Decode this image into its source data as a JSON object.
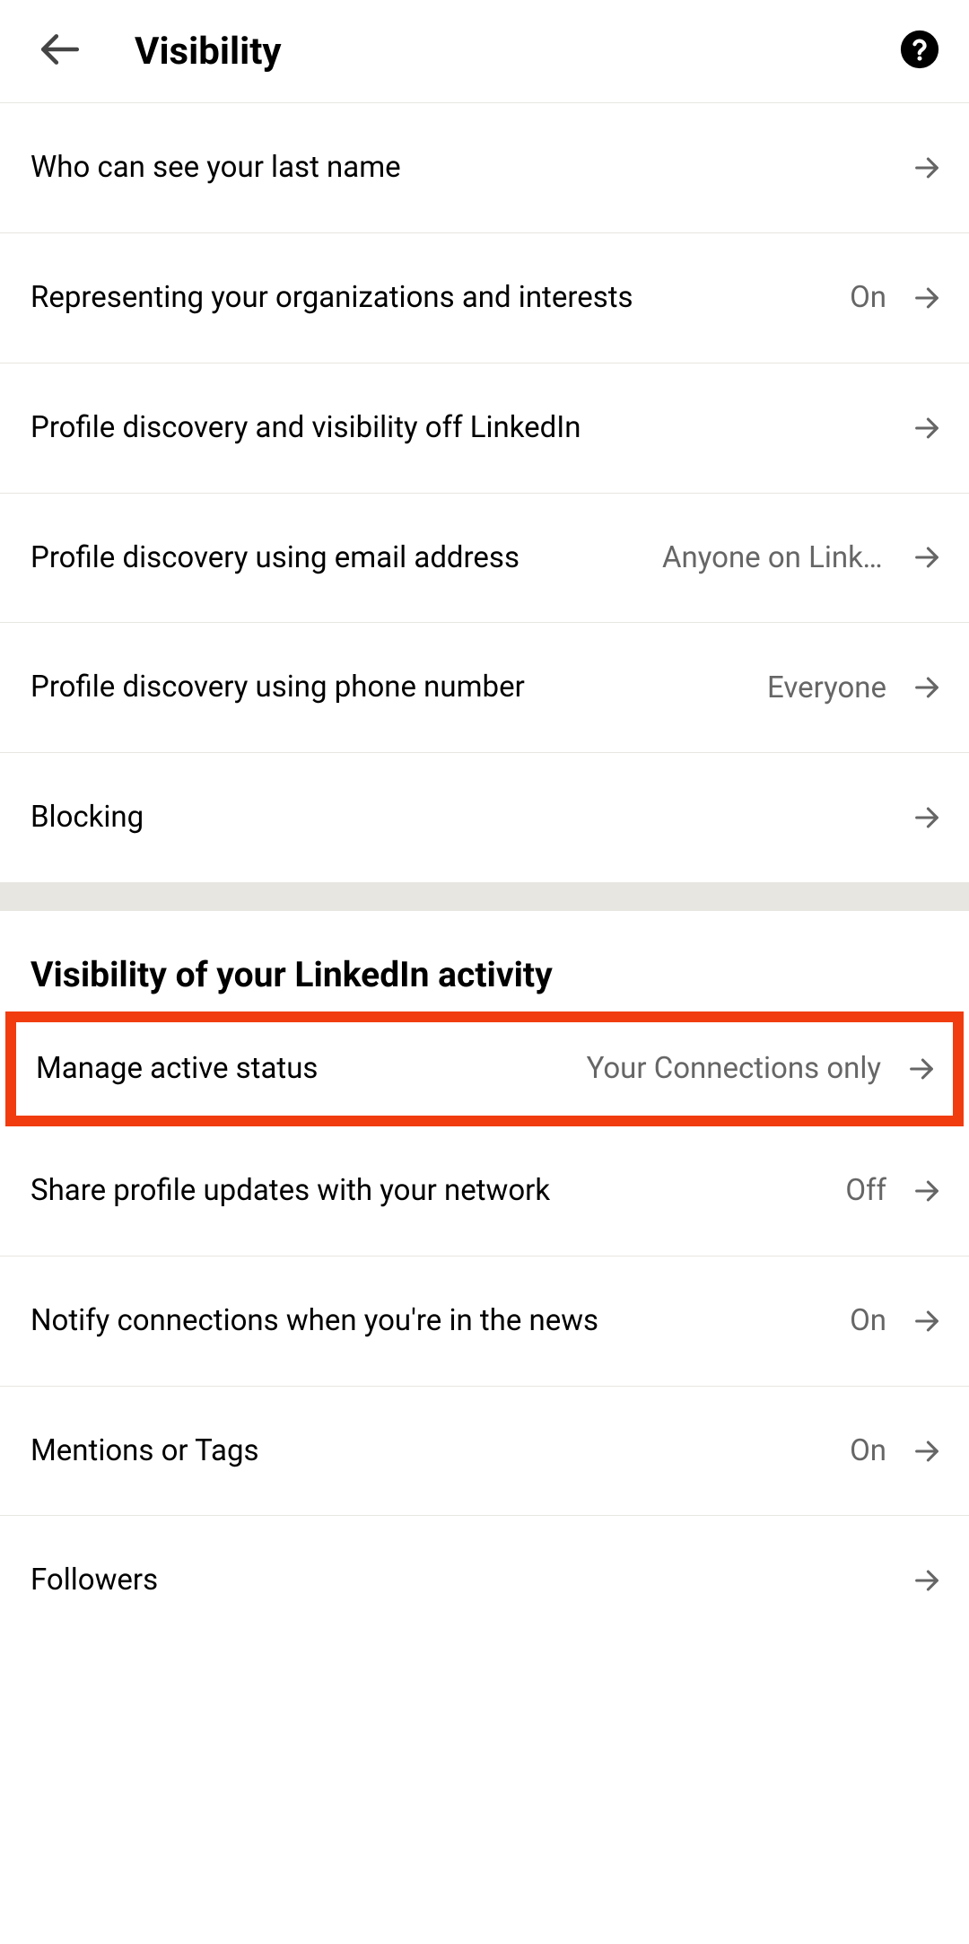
{
  "header": {
    "title": "Visibility"
  },
  "section1": {
    "items": [
      {
        "label": "Who can see your last name",
        "value": ""
      },
      {
        "label": "Representing your organizations and interests",
        "value": "On"
      },
      {
        "label": "Profile discovery and visibility off LinkedIn",
        "value": ""
      },
      {
        "label": "Profile discovery using email address",
        "value": "Anyone on LinkedIn"
      },
      {
        "label": "Profile discovery using phone number",
        "value": "Everyone"
      },
      {
        "label": "Blocking",
        "value": ""
      }
    ]
  },
  "section2": {
    "header": "Visibility of your LinkedIn activity",
    "items": [
      {
        "label": "Manage active status",
        "value": "Your Connections only",
        "highlighted": true
      },
      {
        "label": "Share profile updates with your network",
        "value": "Off"
      },
      {
        "label": "Notify connections when you're in the news",
        "value": "On"
      },
      {
        "label": "Mentions or Tags",
        "value": "On"
      },
      {
        "label": "Followers",
        "value": ""
      }
    ]
  }
}
